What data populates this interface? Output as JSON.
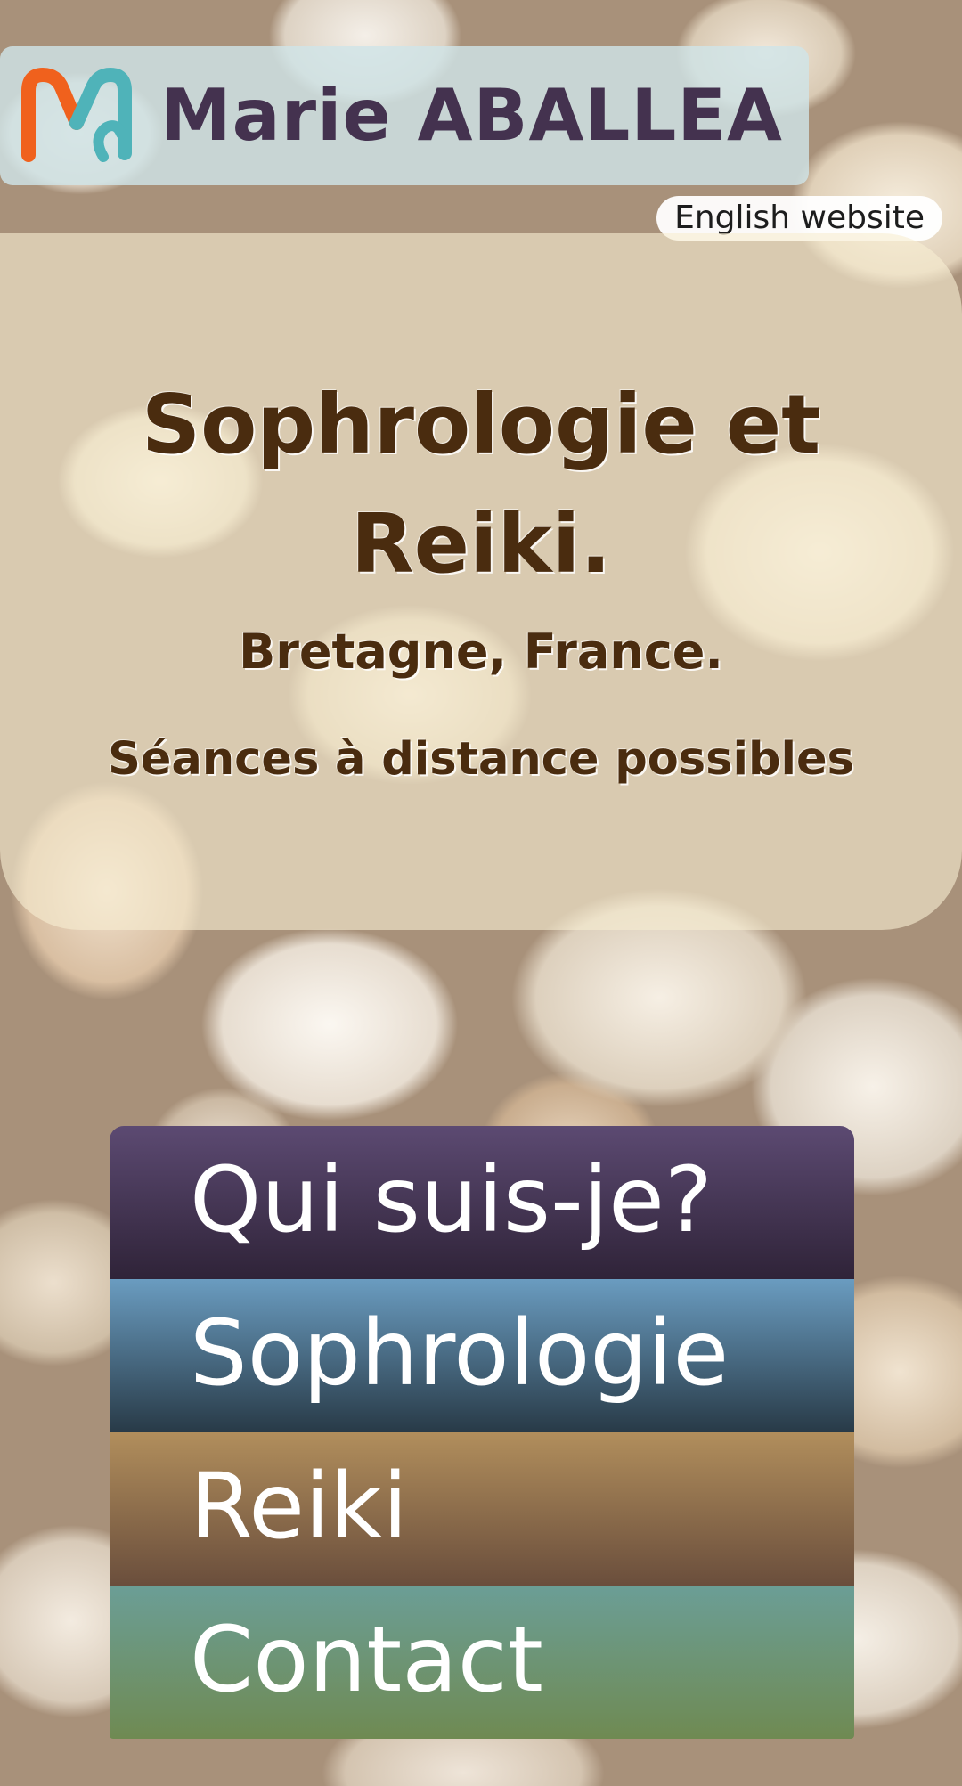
{
  "header": {
    "logo_name": "Marie ABALLEA",
    "logo_colors": {
      "orange": "#f0611d",
      "teal": "#4fb3b9",
      "text": "#44324f"
    }
  },
  "language_link": "English website",
  "hero": {
    "title": "Sophrologie et Reiki.",
    "location": "Bretagne, France.",
    "remote": "Séances à distance possibles"
  },
  "nav": {
    "items": [
      {
        "label": "Qui suis-je?",
        "color": "#4a3a5c"
      },
      {
        "label": "Sophrologie",
        "color": "#4c6f8c"
      },
      {
        "label": "Reiki",
        "color": "#8e7050"
      },
      {
        "label": "Contact",
        "color": "#6c9478"
      }
    ]
  }
}
